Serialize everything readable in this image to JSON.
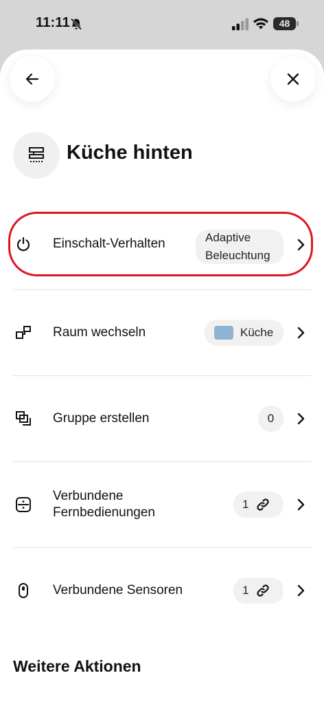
{
  "status_bar": {
    "time": "11:11",
    "battery": "48",
    "icons": [
      "bell-slash-icon",
      "signal-icon",
      "wifi-icon",
      "battery-icon"
    ]
  },
  "header": {
    "back_icon": "arrow-left-icon",
    "close_icon": "close-icon",
    "device_icon": "light-fixture-icon",
    "title": "Küche hinten"
  },
  "rows": [
    {
      "label": "Einschalt-Verhalten",
      "icon": "power-icon",
      "value_line1": "Adaptive",
      "value_line2": "Beleuchtung"
    },
    {
      "label": "Raum wechseln",
      "icon": "room-switch-icon",
      "value": "Küche",
      "swatch_color": "#8fb3d0"
    },
    {
      "label": "Gruppe erstellen",
      "icon": "group-icon",
      "value": "0"
    },
    {
      "label_line1": "Verbundene",
      "label_line2": "Fernbedienungen",
      "icon": "remote-icon",
      "value": "1",
      "value_icon": "link-icon"
    },
    {
      "label": "Verbundene Sensoren",
      "icon": "sensor-icon",
      "value": "1",
      "value_icon": "link-icon"
    }
  ],
  "section_title": "Weitere Aktionen",
  "colors": {
    "highlight": "#e0141e",
    "pill_bg": "#f1f1f1",
    "swatch": "#8fb3d0"
  }
}
